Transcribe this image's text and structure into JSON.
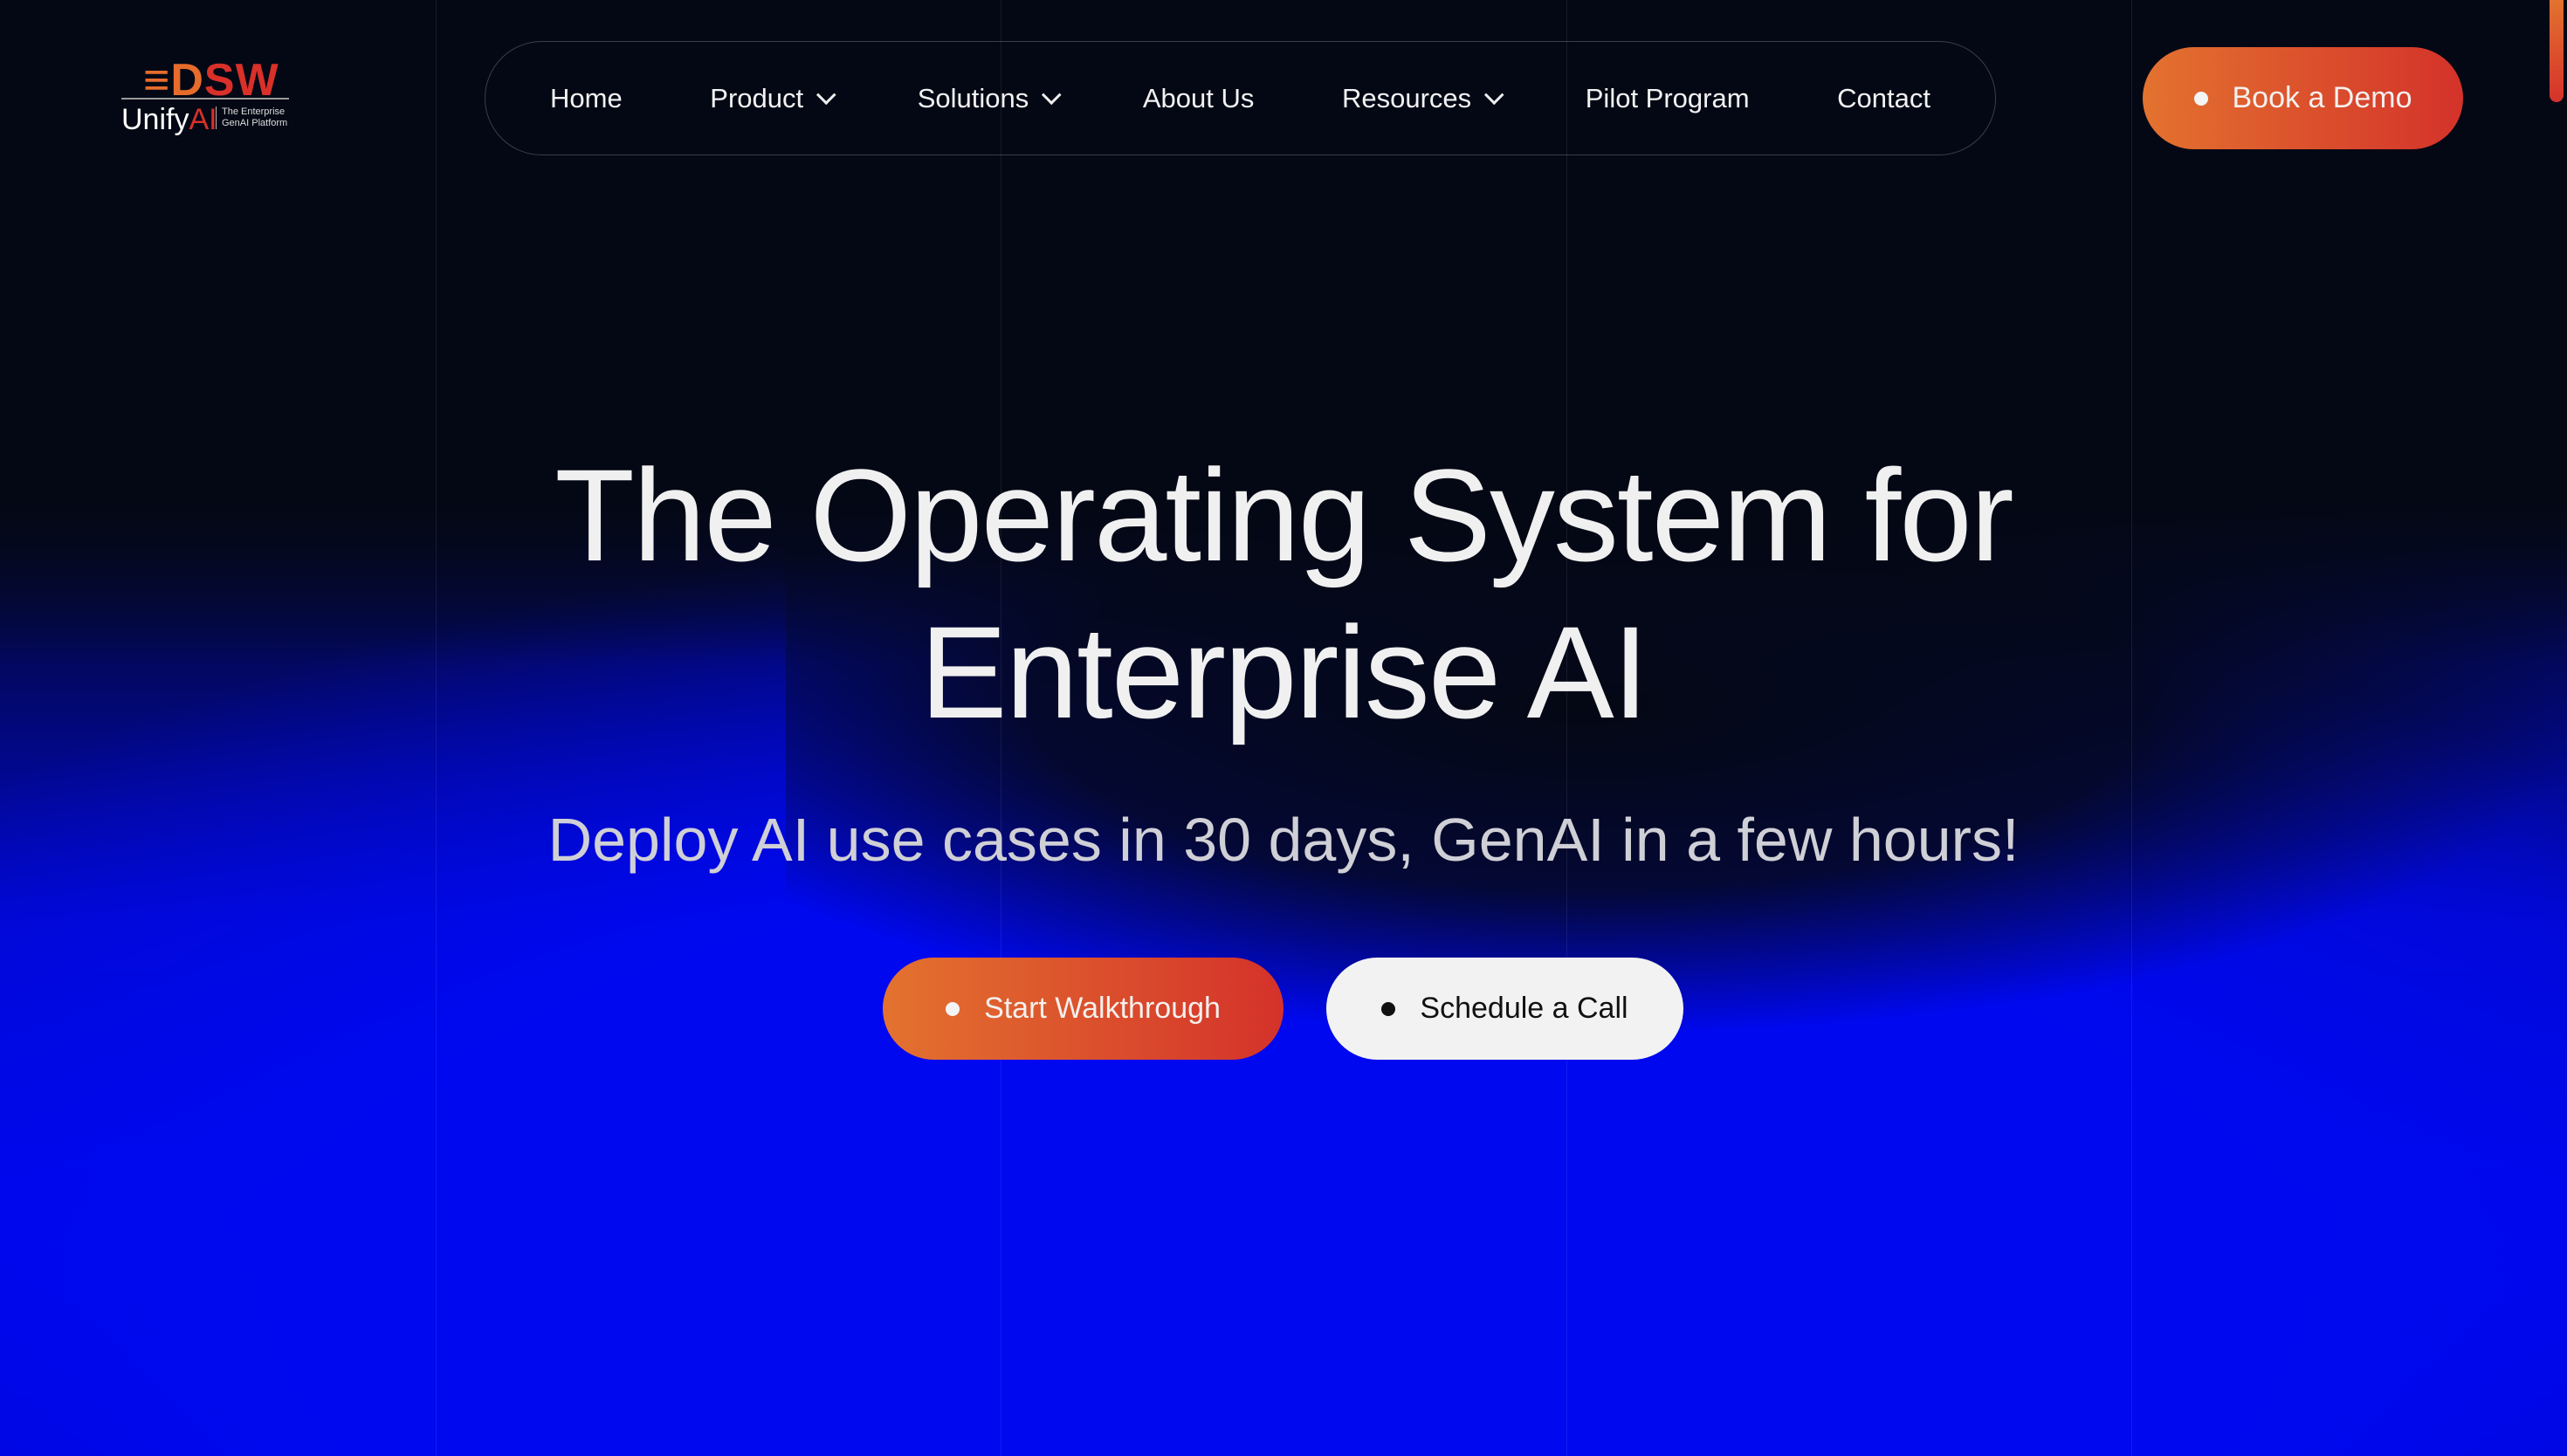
{
  "logo": {
    "mark": "DSW",
    "product_main": "Unify",
    "product_accent": "AI",
    "tagline_1": "The Enterprise",
    "tagline_2": "GenAI Platform"
  },
  "nav": {
    "items": [
      {
        "label": "Home",
        "dropdown": false
      },
      {
        "label": "Product",
        "dropdown": true
      },
      {
        "label": "Solutions",
        "dropdown": true
      },
      {
        "label": "About Us",
        "dropdown": false
      },
      {
        "label": "Resources",
        "dropdown": true
      },
      {
        "label": "Pilot Program",
        "dropdown": false
      },
      {
        "label": "Contact",
        "dropdown": false
      }
    ]
  },
  "cta": {
    "book_demo": "Book a Demo"
  },
  "hero": {
    "title_line1": "The Operating System for",
    "title_line2": "Enterprise AI",
    "subtitle": "Deploy AI use cases in 30 days, GenAI in a few hours!",
    "primary": "Start Walkthrough",
    "secondary": "Schedule a Call"
  },
  "colors": {
    "accent_start": "#e3722f",
    "accent_end": "#d4322a",
    "background": "#040814",
    "glow": "#0008f0"
  }
}
